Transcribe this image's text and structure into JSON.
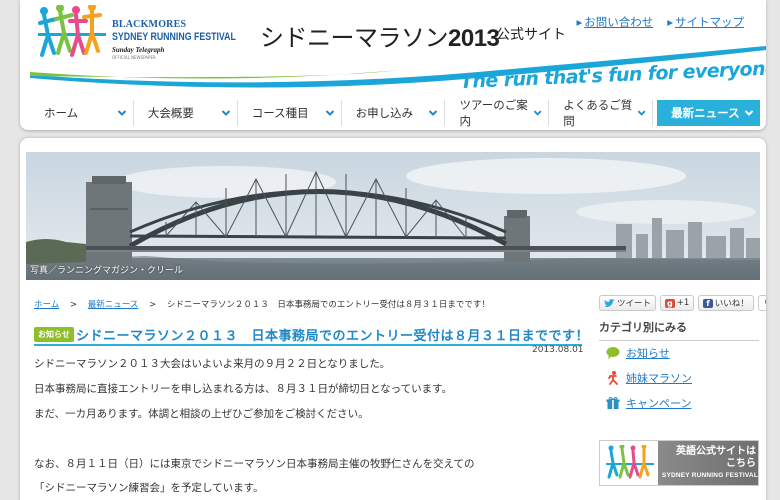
{
  "brand": {
    "line1": "BLACKMORES",
    "line2": "SYDNEY RUNNING FESTIVAL",
    "line3": "Sunday Telegraph",
    "line4": "OFFICIAL NEWSPAPER"
  },
  "header": {
    "title_prefix": "シドニーマラソン",
    "title_year": "2013",
    "title_suffix": "公式サイト",
    "tagline": "The run that's fun for everyone!",
    "utility_links": [
      "お問い合わせ",
      "サイトマップ"
    ]
  },
  "nav": {
    "items": [
      "ホーム",
      "大会概要",
      "コース種目",
      "お申し込み",
      "ツアーのご案内",
      "よくあるご質問",
      "最新ニュース"
    ]
  },
  "hero": {
    "caption": "写真／ランニングマガジン・クリール"
  },
  "breadcrumb": {
    "home": "ホーム",
    "news": "最新ニュース",
    "current": "シドニーマラソン２０１３　日本事務局でのエントリー受付は８月３１日までです！"
  },
  "article": {
    "badge": "お知らせ",
    "title": "シドニーマラソン２０１３　日本事務局でのエントリー受付は８月３１日までです！",
    "date": "2013.08.01",
    "paragraphs": [
      "シドニーマラソン２０１３大会はいよいよ来月の９月２２日となりました。",
      "日本事務局に直接エントリーを申し込まれる方は、８月３１日が締切日となっています。",
      "まだ、一カ月あります。体調と相談の上ぜひご参加をご検討ください。",
      "なお、８月１１日（日）には東京でシドニーマラソン日本事務局主催の牧野仁さんを交えての",
      "「シドニーマラソン練習会」を予定しています。"
    ]
  },
  "share": {
    "tweet": "ツイート",
    "gplus": "+1",
    "like": "いいね！",
    "like_count": "0"
  },
  "sidebar": {
    "category_title": "カテゴリ別にみる",
    "categories": [
      {
        "label": "お知らせ",
        "icon": "speech-bubble-icon"
      },
      {
        "label": "姉妹マラソン",
        "icon": "runner-icon"
      },
      {
        "label": "キャンペーン",
        "icon": "gift-icon"
      }
    ],
    "banner": {
      "line1": "英語公式サイトは",
      "line2": "こちら",
      "line3": "SYDNEY RUNNING FESTIVAL"
    }
  },
  "colors": {
    "accent": "#2bb0dc",
    "link": "#1f78c8",
    "badge": "#8cbf2a",
    "swoosh_green": "#7cc242",
    "swoosh_blue": "#1aa6d8"
  }
}
